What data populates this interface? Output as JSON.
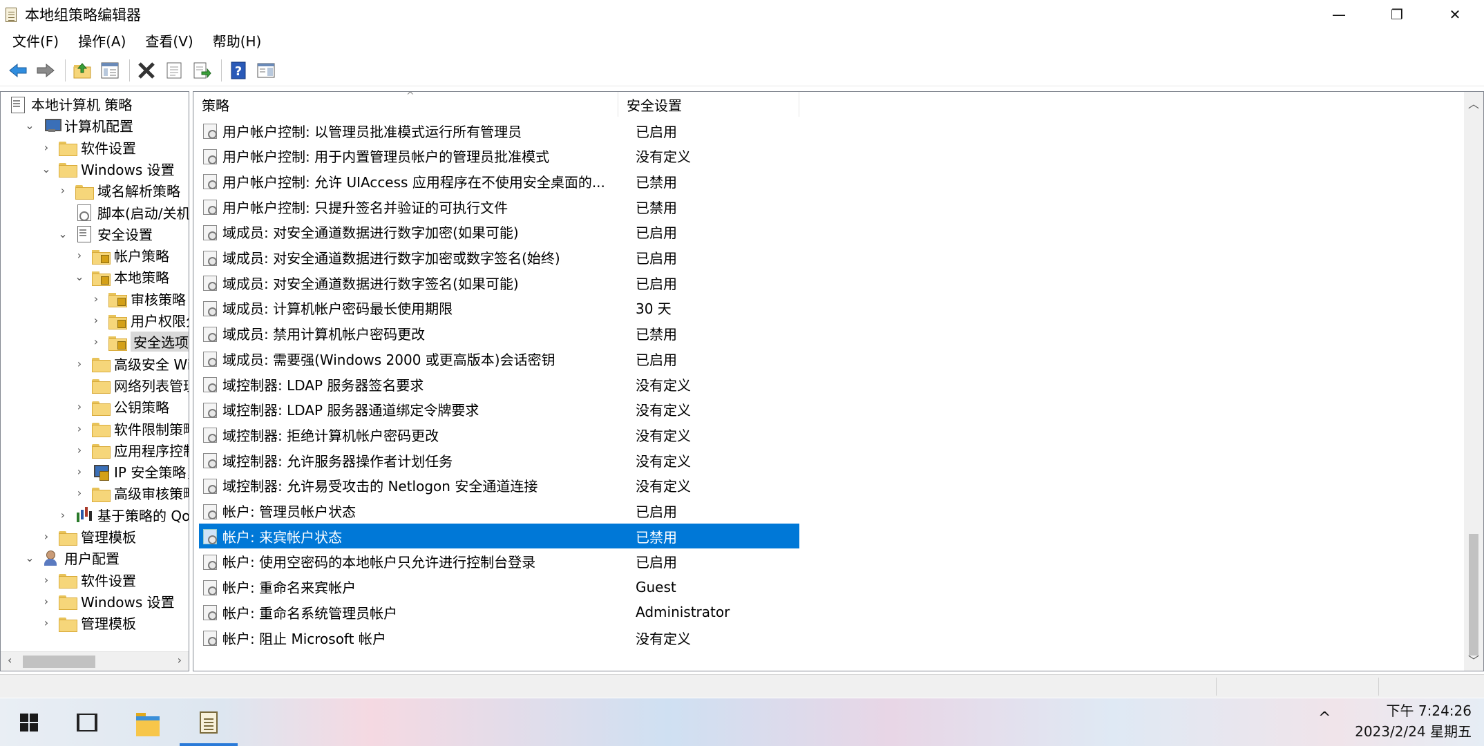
{
  "window": {
    "title": "本地组策略编辑器",
    "controls": {
      "minimize": "—",
      "restore": "❐",
      "close": "✕"
    }
  },
  "menu": [
    "文件(F)",
    "操作(A)",
    "查看(V)",
    "帮助(H)"
  ],
  "toolbar": {
    "icons": [
      "back-arrow-icon",
      "forward-arrow-icon",
      "up-folder-icon",
      "show-hide-tree-icon",
      "delete-icon",
      "properties-icon",
      "export-list-icon",
      "help-icon",
      "show-action-pane-icon"
    ]
  },
  "tree": [
    {
      "label": "本地计算机 策略",
      "indent": 0,
      "icon": "policy-doc-icon",
      "chevron": ""
    },
    {
      "label": "计算机配置",
      "indent": 1,
      "icon": "computer-icon",
      "chevron": "⌄"
    },
    {
      "label": "软件设置",
      "indent": 2,
      "icon": "folder-icon",
      "chevron": "›"
    },
    {
      "label": "Windows 设置",
      "indent": 2,
      "icon": "folder-icon",
      "chevron": "⌄"
    },
    {
      "label": "域名解析策略",
      "indent": 3,
      "icon": "folder-icon",
      "chevron": "›"
    },
    {
      "label": "脚本(启动/关机)",
      "indent": 3,
      "icon": "gear-doc-icon",
      "chevron": ""
    },
    {
      "label": "安全设置",
      "indent": 3,
      "icon": "policy-doc-icon",
      "chevron": "⌄"
    },
    {
      "label": "帐户策略",
      "indent": 4,
      "icon": "lock-folder-icon",
      "chevron": "›"
    },
    {
      "label": "本地策略",
      "indent": 4,
      "icon": "lock-folder-icon",
      "chevron": "⌄"
    },
    {
      "label": "审核策略",
      "indent": 5,
      "icon": "lock-folder-icon",
      "chevron": "›"
    },
    {
      "label": "用户权限分配",
      "indent": 5,
      "icon": "lock-folder-icon",
      "chevron": "›"
    },
    {
      "label": "安全选项",
      "indent": 5,
      "icon": "lock-folder-icon",
      "chevron": "›",
      "selected": true
    },
    {
      "label": "高级安全 Windows Defender 防火墙",
      "indent": 4,
      "icon": "folder-icon",
      "chevron": "›"
    },
    {
      "label": "网络列表管理器策略",
      "indent": 4,
      "icon": "folder-icon",
      "chevron": ""
    },
    {
      "label": "公钥策略",
      "indent": 4,
      "icon": "folder-icon",
      "chevron": "›"
    },
    {
      "label": "软件限制策略",
      "indent": 4,
      "icon": "folder-icon",
      "chevron": "›"
    },
    {
      "label": "应用程序控制策略",
      "indent": 4,
      "icon": "folder-icon",
      "chevron": "›"
    },
    {
      "label": "IP 安全策略，在 本地计算机",
      "indent": 4,
      "icon": "ip-security-icon",
      "chevron": "›"
    },
    {
      "label": "高级审核策略配置",
      "indent": 4,
      "icon": "folder-icon",
      "chevron": "›"
    },
    {
      "label": "基于策略的 QoS",
      "indent": 3,
      "icon": "bar-chart-icon",
      "chevron": "›"
    },
    {
      "label": "管理模板",
      "indent": 2,
      "icon": "folder-icon",
      "chevron": "›"
    },
    {
      "label": "用户配置",
      "indent": 1,
      "icon": "user-icon",
      "chevron": "⌄"
    },
    {
      "label": "软件设置",
      "indent": 2,
      "icon": "folder-icon",
      "chevron": "›"
    },
    {
      "label": "Windows 设置",
      "indent": 2,
      "icon": "folder-icon",
      "chevron": "›"
    },
    {
      "label": "管理模板",
      "indent": 2,
      "icon": "folder-icon",
      "chevron": "›"
    }
  ],
  "list": {
    "columns": [
      "策略",
      "安全设置"
    ],
    "sort_indicator": "^",
    "rows": [
      {
        "policy": "用户帐户控制: 以管理员批准模式运行所有管理员",
        "setting": "已启用"
      },
      {
        "policy": "用户帐户控制: 用于内置管理员帐户的管理员批准模式",
        "setting": "没有定义"
      },
      {
        "policy": "用户帐户控制: 允许 UIAccess 应用程序在不使用安全桌面的...",
        "setting": "已禁用"
      },
      {
        "policy": "用户帐户控制: 只提升签名并验证的可执行文件",
        "setting": "已禁用"
      },
      {
        "policy": "域成员: 对安全通道数据进行数字加密(如果可能)",
        "setting": "已启用"
      },
      {
        "policy": "域成员: 对安全通道数据进行数字加密或数字签名(始终)",
        "setting": "已启用"
      },
      {
        "policy": "域成员: 对安全通道数据进行数字签名(如果可能)",
        "setting": "已启用"
      },
      {
        "policy": "域成员: 计算机帐户密码最长使用期限",
        "setting": "30 天"
      },
      {
        "policy": "域成员: 禁用计算机帐户密码更改",
        "setting": "已禁用"
      },
      {
        "policy": "域成员: 需要强(Windows 2000 或更高版本)会话密钥",
        "setting": "已启用"
      },
      {
        "policy": "域控制器: LDAP 服务器签名要求",
        "setting": "没有定义"
      },
      {
        "policy": "域控制器: LDAP 服务器通道绑定令牌要求",
        "setting": "没有定义"
      },
      {
        "policy": "域控制器: 拒绝计算机帐户密码更改",
        "setting": "没有定义"
      },
      {
        "policy": "域控制器: 允许服务器操作者计划任务",
        "setting": "没有定义"
      },
      {
        "policy": "域控制器: 允许易受攻击的 Netlogon 安全通道连接",
        "setting": "没有定义"
      },
      {
        "policy": "帐户: 管理员帐户状态",
        "setting": "已启用"
      },
      {
        "policy": "帐户: 来宾帐户状态",
        "setting": "已禁用",
        "selected": true
      },
      {
        "policy": "帐户: 使用空密码的本地帐户只允许进行控制台登录",
        "setting": "已启用"
      },
      {
        "policy": "帐户: 重命名来宾帐户",
        "setting": "Guest"
      },
      {
        "policy": "帐户: 重命名系统管理员帐户",
        "setting": "Administrator"
      },
      {
        "policy": "帐户: 阻止 Microsoft 帐户",
        "setting": "没有定义"
      }
    ]
  },
  "taskbar": {
    "clock_time": "下午 7:24:26",
    "clock_date": "2023/2/24 星期五",
    "tray_chevron": "^"
  },
  "colors": {
    "selection": "#0078d7",
    "accent": "#2a7ad8"
  }
}
